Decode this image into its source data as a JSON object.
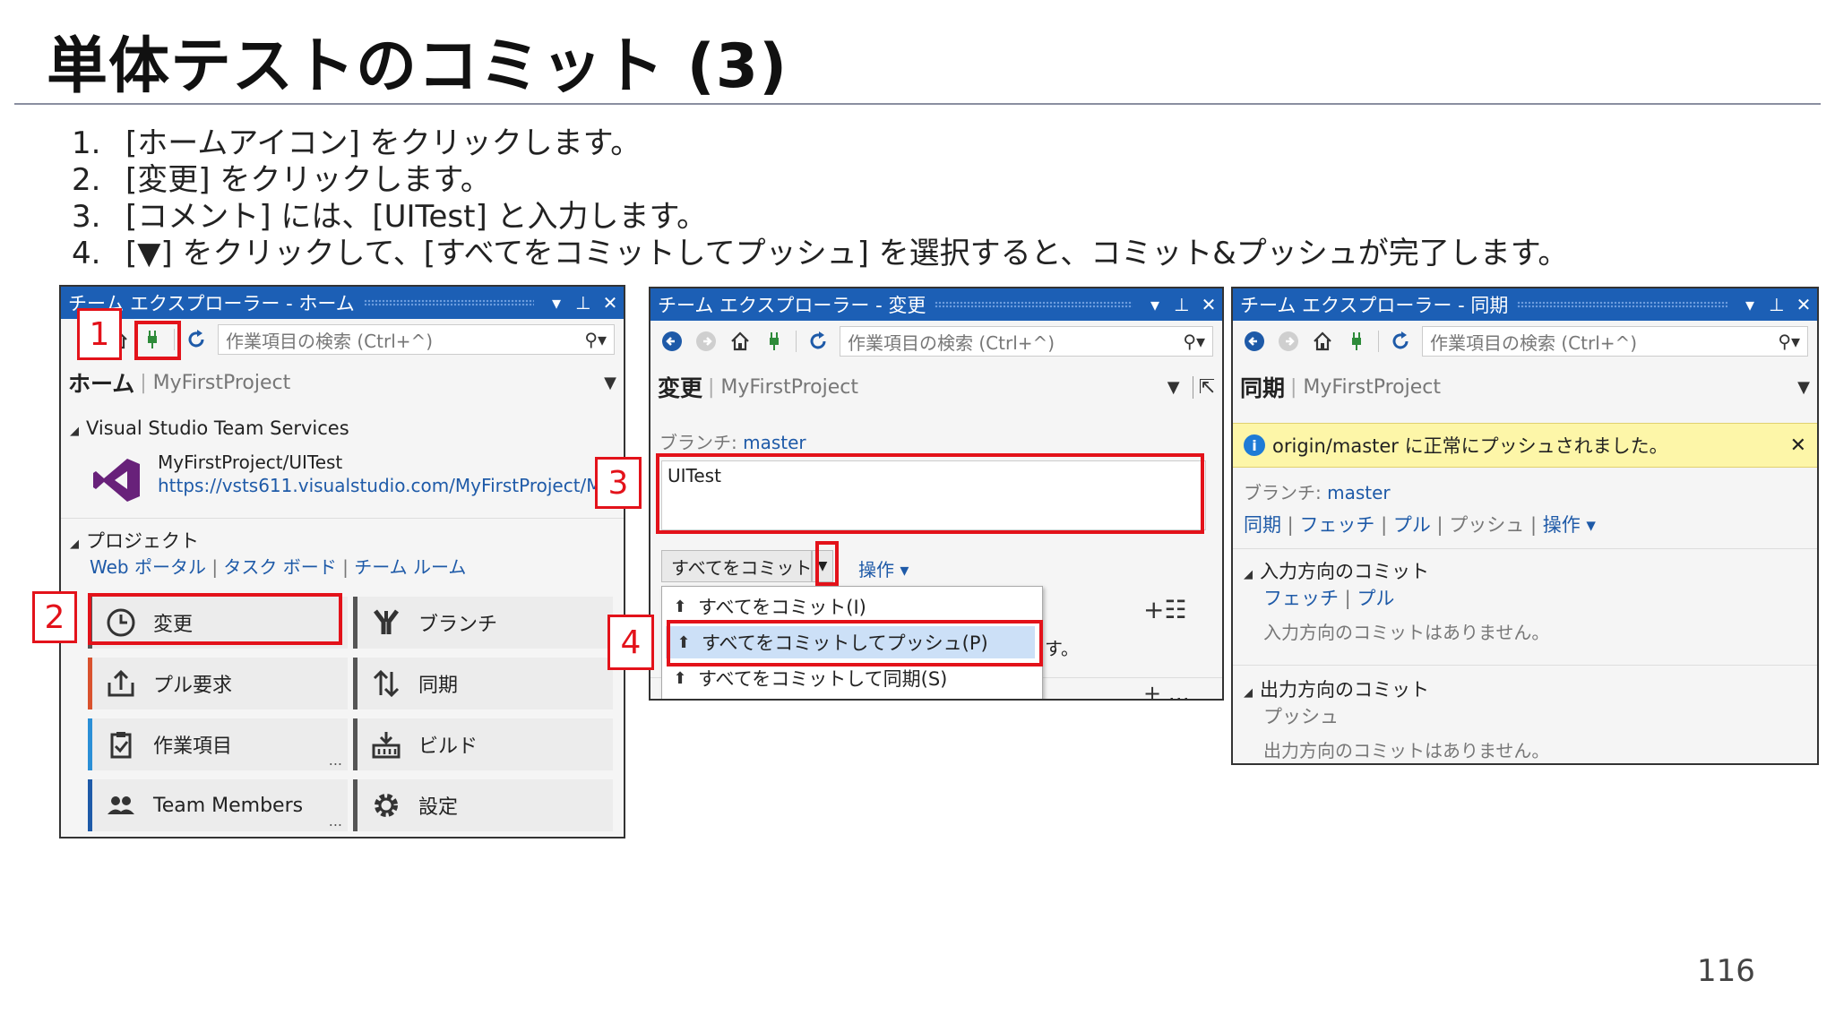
{
  "slide": {
    "title": "単体テストのコミット (3)",
    "steps": [
      {
        "num": "1.",
        "text": "[ホームアイコン] をクリックします。"
      },
      {
        "num": "2.",
        "text": "[変更] をクリックします。"
      },
      {
        "num": "3.",
        "text": "[コメント] には、[UITest] と入力します。"
      },
      {
        "num": "4.",
        "text": "[▼] をクリックして、[すべてをコミットしてプッシュ] を選択すると、コミット&プッシュが完了します。"
      }
    ],
    "page_number": "116"
  },
  "callouts": [
    "1",
    "2",
    "3",
    "4"
  ],
  "panel_home": {
    "title": "チーム エクスプローラー - ホーム",
    "search_placeholder": "作業項目の検索 (Ctrl+^)",
    "page_name": "ホーム",
    "project": "MyFirstProject",
    "vsts_section": "Visual Studio Team Services",
    "repo_name": "MyFirstProject/UITest",
    "repo_url": "https://vsts611.visualstudio.com/MyFirstProject/M...",
    "project_section": "プロジェクト",
    "links": [
      "Web ポータル",
      "タスク ボード",
      "チーム ルーム"
    ],
    "tiles": [
      {
        "label": "変更",
        "icon": "clock-icon",
        "color": "#555555"
      },
      {
        "label": "ブランチ",
        "icon": "branch-icon",
        "color": "#555555"
      },
      {
        "label": "プル要求",
        "icon": "pull-request-icon",
        "color": "#d9522e"
      },
      {
        "label": "同期",
        "icon": "sync-icon",
        "color": "#555555"
      },
      {
        "label": "作業項目",
        "icon": "work-item-icon",
        "color": "#2b8fd6"
      },
      {
        "label": "ビルド",
        "icon": "build-icon",
        "color": "#555555"
      },
      {
        "label": "Team Members",
        "icon": "team-members-icon",
        "color": "#1e5aa8"
      },
      {
        "label": "設定",
        "icon": "settings-gear-icon",
        "color": "#555555"
      }
    ],
    "more": "..."
  },
  "panel_changes": {
    "title": "チーム エクスプローラー - 変更",
    "search_placeholder": "作業項目の検索 (Ctrl+^)",
    "page_name": "変更",
    "project": "MyFirstProject",
    "branch_label": "ブランチ:",
    "branch": "master",
    "comment": "UITest",
    "commit_all_button": "すべてをコミット(I)",
    "actions": "操作",
    "dropdown": [
      "すべてをコミット(I)",
      "すべてをコミットしてプッシュ(P)",
      "すべてをコミットして同期(S)"
    ],
    "partial_text": "す。"
  },
  "panel_sync": {
    "title": "チーム エクスプローラー - 同期",
    "search_placeholder": "作業項目の検索 (Ctrl+^)",
    "page_name": "同期",
    "project": "MyFirstProject",
    "notification": "origin/master に正常にプッシュされました。",
    "branch_label": "ブランチ:",
    "branch": "master",
    "links": [
      "同期",
      "フェッチ",
      "プル",
      "プッシュ"
    ],
    "actions": "操作",
    "incoming_title": "入力方向のコミット",
    "incoming_links": [
      "フェッチ",
      "プル"
    ],
    "incoming_empty": "入力方向のコミットはありません。",
    "outgoing_title": "出力方向のコミット",
    "outgoing_link": "プッシュ",
    "outgoing_empty": "出力方向のコミットはありません。"
  },
  "colors": {
    "title_bar": "#1c5fb5",
    "callout": "#e3121a",
    "link": "#1e5aa8",
    "notification": "#fdf6a8",
    "selected": "#cce0f7"
  }
}
